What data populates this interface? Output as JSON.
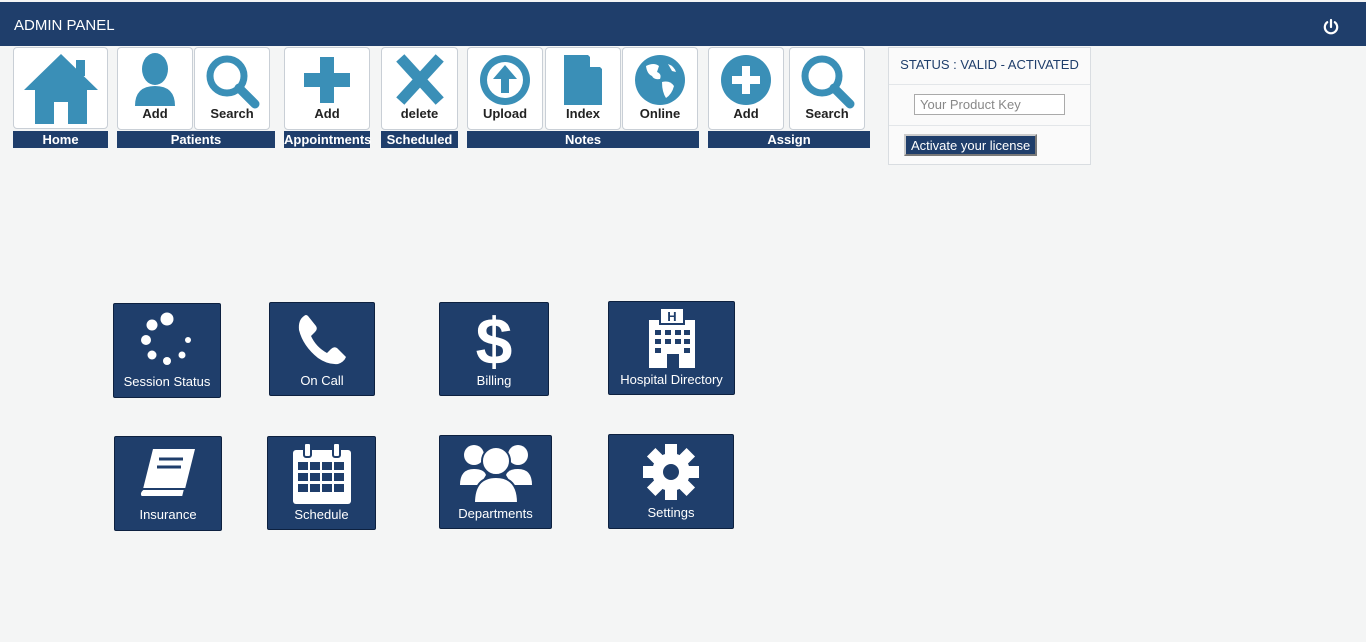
{
  "header": {
    "title": "ADMIN PANEL",
    "power_icon": "power-icon"
  },
  "toolbar": {
    "home": {
      "label": "Home",
      "group": "Home"
    },
    "patients": {
      "group": "Patients",
      "add": "Add",
      "search": "Search"
    },
    "appointments": {
      "group": "Appointments",
      "add": "Add"
    },
    "scheduled": {
      "group": "Scheduled",
      "delete": "delete"
    },
    "notes": {
      "group": "Notes",
      "upload": "Upload",
      "index": "Index",
      "online": "Online"
    },
    "assign": {
      "group": "Assign",
      "add": "Add",
      "search": "Search"
    }
  },
  "license": {
    "status": "STATUS : VALID - ACTIVATED",
    "key_placeholder": "Your Product Key",
    "key_value": "",
    "activate_label": "Activate your license"
  },
  "tiles": {
    "session_status": "Session Status",
    "on_call": "On Call",
    "billing": "Billing",
    "hospital_directory": "Hospital Directory",
    "insurance": "Insurance",
    "schedule": "Schedule",
    "departments": "Departments",
    "settings": "Settings"
  },
  "colors": {
    "navy": "#1f3e6b",
    "icon_teal": "#3a8fb7",
    "page_bg": "#f4f5f5"
  }
}
